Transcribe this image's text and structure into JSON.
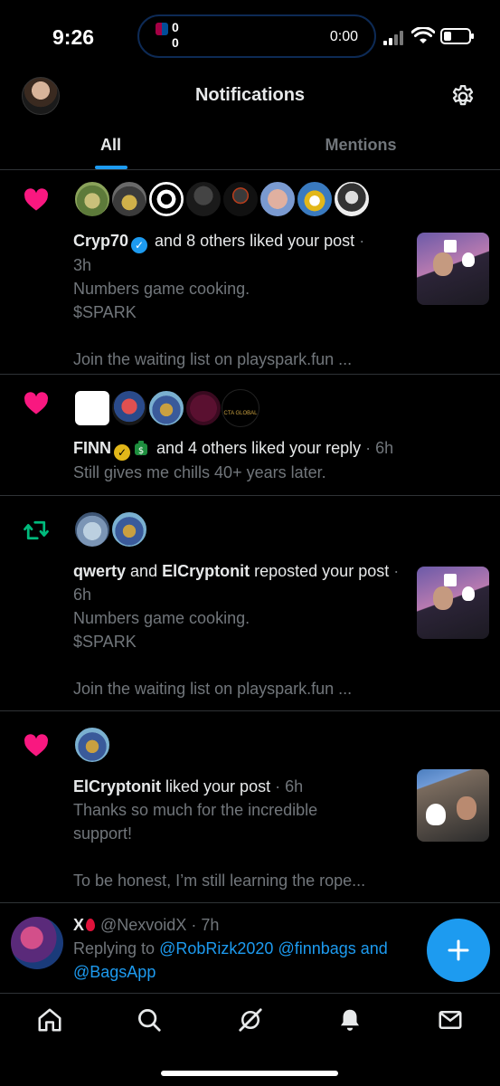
{
  "status_bar": {
    "time": "9:26",
    "score_home": "0",
    "score_away": "0",
    "match_clock": "0:00"
  },
  "header": {
    "title": "Notifications"
  },
  "tabs": [
    {
      "label": "All",
      "active": true
    },
    {
      "label": "Mentions",
      "active": false
    }
  ],
  "notifications": [
    {
      "type": "like",
      "actor": "Cryp70",
      "rest": "and 8 others liked your post",
      "time": "3h",
      "body": [
        "Numbers game cooking.",
        "$SPARK",
        "",
        "Join the waiting list on playspark.fun ..."
      ]
    },
    {
      "type": "like",
      "actor": "FINN",
      "rest": "and 4 others liked your reply",
      "time": "6h",
      "body": [
        "Still gives me chills 40+ years later."
      ]
    },
    {
      "type": "repost",
      "actor": "qwerty",
      "and": "and",
      "actor2": "ElCryptonit",
      "rest": "reposted your",
      "rest2": "post",
      "time": "6h",
      "body": [
        "Numbers game cooking.",
        "$SPARK",
        "",
        "Join the waiting list on playspark.fun ..."
      ]
    },
    {
      "type": "like",
      "actor": "ElCryptonit",
      "rest": "liked your post",
      "time": "6h",
      "body": [
        "Thanks so much for the incredible",
        "support!",
        "",
        "To be honest, I’m still learning the rope..."
      ]
    }
  ],
  "reply": {
    "name": "X",
    "handle": "@NexvoidX",
    "time": "7h",
    "replying_to": "Replying to",
    "mentions": [
      "@RobRizk2020",
      "@finnbags",
      "and",
      "@BagsApp"
    ]
  },
  "colors": {
    "accent": "#1d9bf0",
    "like": "#f91880",
    "repost": "#00ba7c",
    "muted": "#71767b",
    "divider": "#2f3336"
  },
  "icons": [
    "heart-icon",
    "repost-icon",
    "gear-icon",
    "home-icon",
    "search-icon",
    "grok-icon",
    "bell-icon",
    "mail-icon",
    "plus-icon"
  ]
}
